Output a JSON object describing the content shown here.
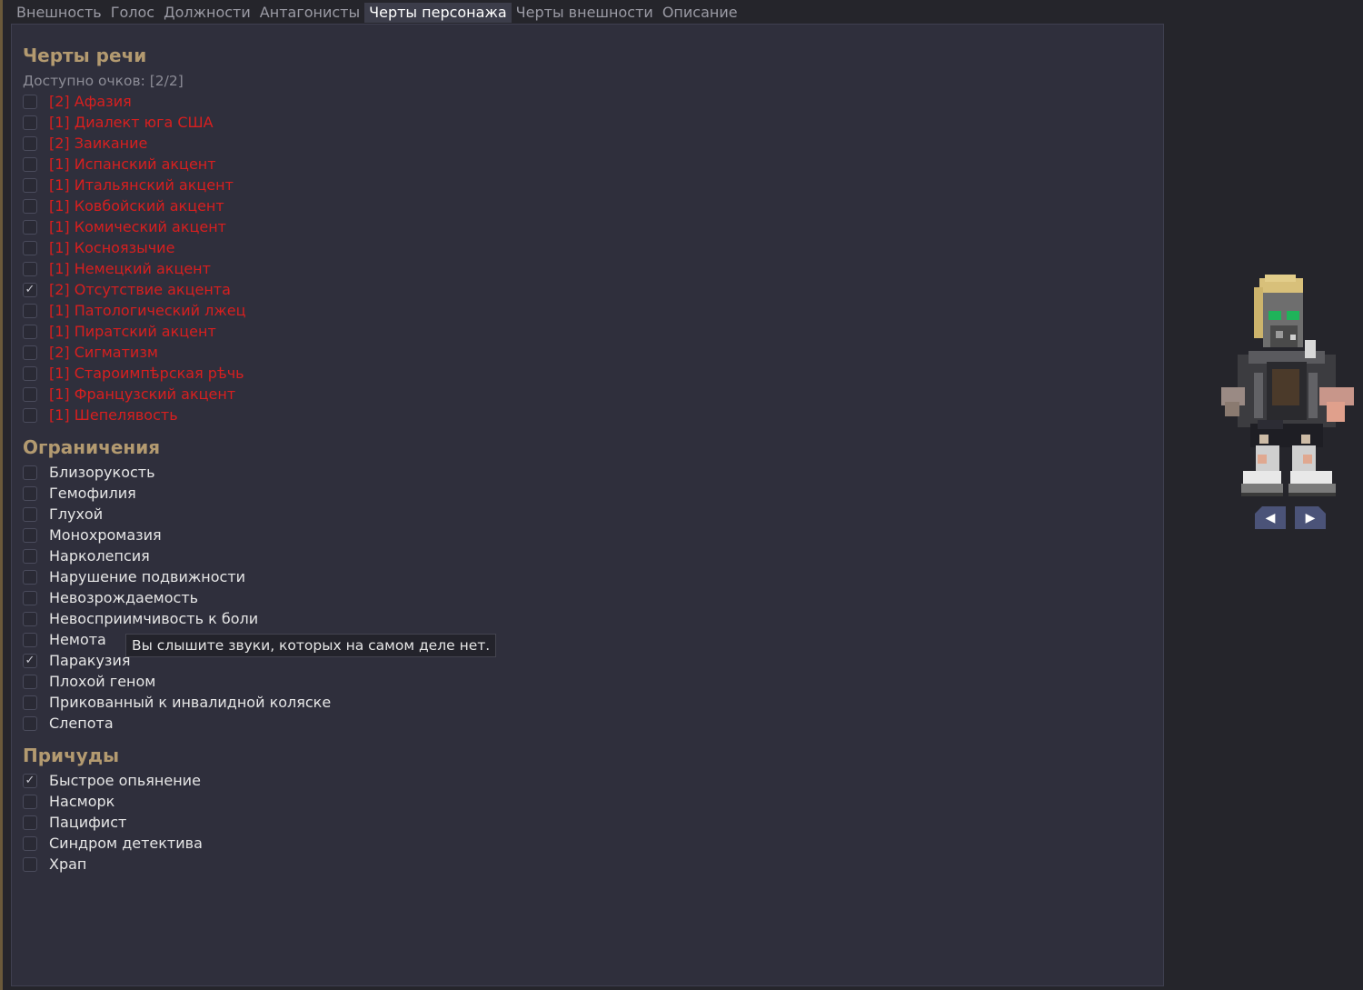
{
  "tabs": [
    {
      "label": "Внешность",
      "active": false
    },
    {
      "label": "Голос",
      "active": false
    },
    {
      "label": "Должности",
      "active": false
    },
    {
      "label": "Антагонисты",
      "active": false
    },
    {
      "label": "Черты персонажа",
      "active": true
    },
    {
      "label": "Черты внешности",
      "active": false
    },
    {
      "label": "Описание",
      "active": false
    }
  ],
  "speech": {
    "title": "Черты речи",
    "points": "Доступно очков: [2/2]",
    "items": [
      {
        "label": "[2] Афазия",
        "checked": false
      },
      {
        "label": "[1] Диалект юга США",
        "checked": false
      },
      {
        "label": "[2] Заикание",
        "checked": false
      },
      {
        "label": "[1] Испанский акцент",
        "checked": false
      },
      {
        "label": "[1] Итальянский акцент",
        "checked": false
      },
      {
        "label": "[1] Ковбойский акцент",
        "checked": false
      },
      {
        "label": "[1] Комический акцент",
        "checked": false
      },
      {
        "label": "[1] Косноязычие",
        "checked": false
      },
      {
        "label": "[1] Немецкий акцент",
        "checked": false
      },
      {
        "label": "[2] Отсутствие акцента",
        "checked": true
      },
      {
        "label": "[1] Патологический лжец",
        "checked": false
      },
      {
        "label": "[1] Пиратский акцент",
        "checked": false
      },
      {
        "label": "[2] Сигматизм",
        "checked": false
      },
      {
        "label": "[1] Староимпѣрская рѣчь",
        "checked": false
      },
      {
        "label": "[1] Французский акцент",
        "checked": false
      },
      {
        "label": "[1] Шепелявость",
        "checked": false
      }
    ]
  },
  "restrictions": {
    "title": "Ограничения",
    "items": [
      {
        "label": "Близорукость",
        "checked": false
      },
      {
        "label": "Гемофилия",
        "checked": false
      },
      {
        "label": "Глухой",
        "checked": false
      },
      {
        "label": "Монохромазия",
        "checked": false
      },
      {
        "label": "Нарколепсия",
        "checked": false
      },
      {
        "label": "Нарушение подвижности",
        "checked": false
      },
      {
        "label": "Невозрождаемость",
        "checked": false
      },
      {
        "label": "Невосприимчивость к боли",
        "checked": false
      },
      {
        "label": "Немота",
        "checked": false
      },
      {
        "label": "Паракузия",
        "checked": true
      },
      {
        "label": "Плохой геном",
        "checked": false
      },
      {
        "label": "Прикованный к инвалидной коляске",
        "checked": false
      },
      {
        "label": "Слепота",
        "checked": false
      }
    ]
  },
  "quirks": {
    "title": "Причуды",
    "items": [
      {
        "label": "Быстрое опьянение",
        "checked": true
      },
      {
        "label": "Насморк",
        "checked": false
      },
      {
        "label": "Пацифист",
        "checked": false
      },
      {
        "label": "Синдром детектива",
        "checked": false
      },
      {
        "label": "Храп",
        "checked": false
      }
    ]
  },
  "tooltip": "Вы слышите звуки, которых на самом деле нет.",
  "preview": {
    "rotate_left_icon": "◀",
    "rotate_right_icon": "▶"
  },
  "colors": {
    "background": "#25252b",
    "panel": "#2f2f3c",
    "heading": "#b39a70",
    "speech_trait": "#d81f1f",
    "text": "#e6e6e6",
    "tab_active": "#3c3d4a",
    "arrow_button": "#4b5378"
  }
}
